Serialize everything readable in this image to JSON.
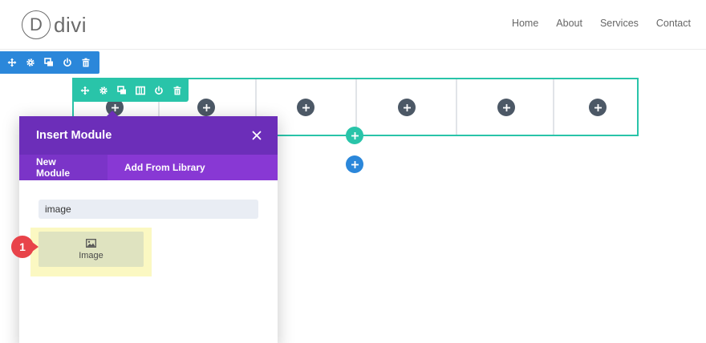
{
  "header": {
    "logo_letter": "D",
    "logo_text": "divi",
    "nav": [
      "Home",
      "About",
      "Services",
      "Contact"
    ]
  },
  "section_toolbar": {
    "color": "#2b87da",
    "icons": [
      "move-icon",
      "gear-icon",
      "duplicate-icon",
      "power-icon",
      "trash-icon"
    ]
  },
  "row_toolbar": {
    "color": "#29c4a9",
    "icons": [
      "move-icon",
      "gear-icon",
      "duplicate-icon",
      "columns-icon",
      "power-icon",
      "trash-icon"
    ]
  },
  "row": {
    "column_count": 6
  },
  "modal": {
    "title": "Insert Module",
    "tabs": [
      {
        "label": "New Module",
        "active": true
      },
      {
        "label": "Add From Library",
        "active": false
      }
    ],
    "search": {
      "value": "image",
      "placeholder": ""
    },
    "modules": [
      {
        "label": "Image",
        "icon": "image-icon"
      }
    ],
    "header_color": "#6c2eb9",
    "tabs_color": "#8838d4"
  },
  "callout": {
    "number": "1",
    "color": "#e8434a"
  }
}
